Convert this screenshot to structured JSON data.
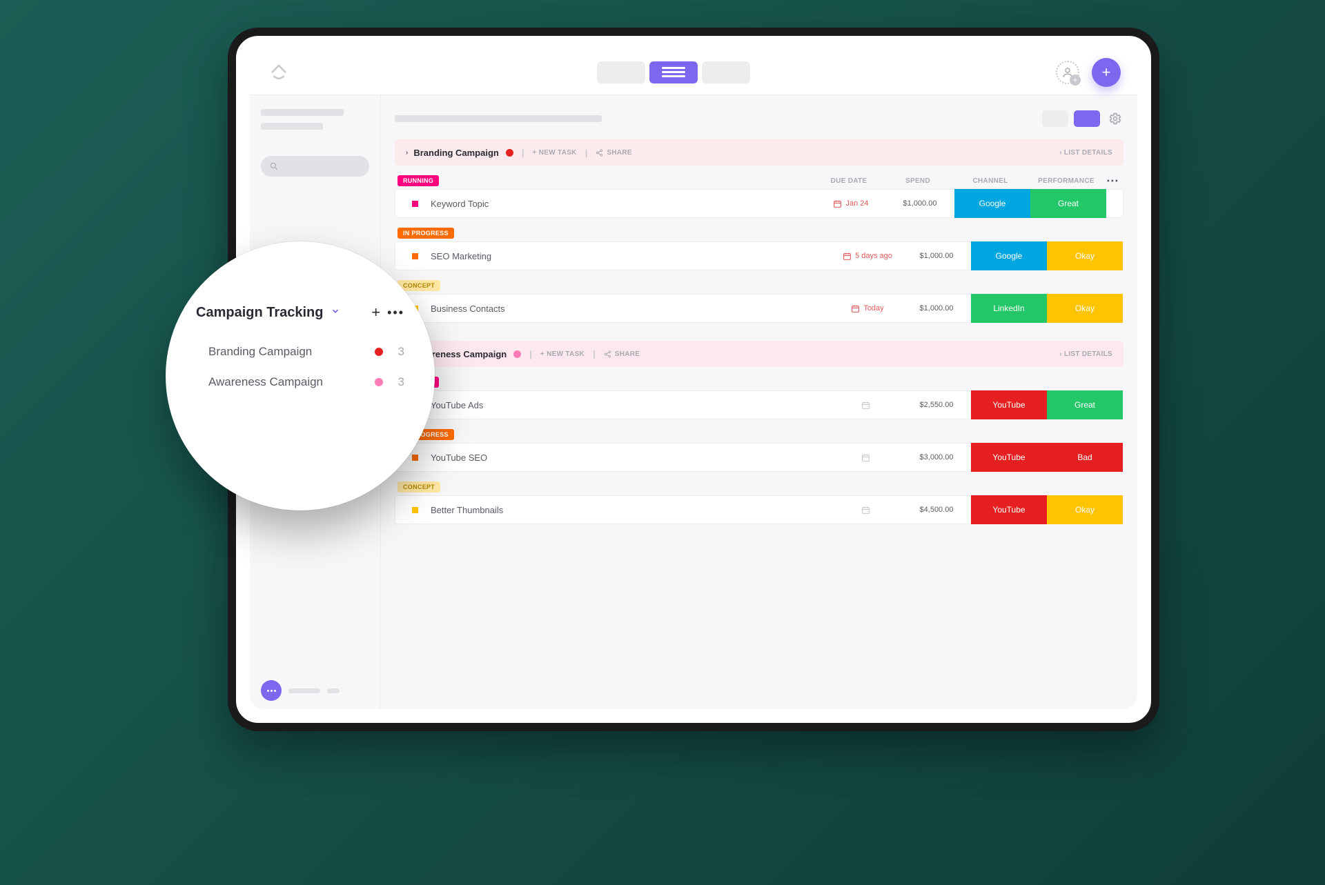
{
  "sidebar_zoom": {
    "title": "Campaign Tracking",
    "items": [
      {
        "name": "Branding Campaign",
        "dot": "red",
        "count": "3"
      },
      {
        "name": "Awareness Campaign",
        "dot": "pink",
        "count": "3"
      }
    ]
  },
  "actions": {
    "new_task": "+ NEW TASK",
    "share": "SHARE",
    "list_details": "› LIST DETAILS"
  },
  "columns": {
    "due": "DUE DATE",
    "spend": "SPEND",
    "channel": "CHANNEL",
    "performance": "PERFORMANCE"
  },
  "status_labels": {
    "running": "RUNNING",
    "in_progress": "IN PROGRESS",
    "concept": "CONCEPT"
  },
  "groups": [
    {
      "title": "Branding Campaign",
      "dot": "red",
      "sections": [
        {
          "status": "running",
          "show_headers": true,
          "tasks": [
            {
              "bullet": "pink",
              "name": "Keyword Topic",
              "due": "Jan 24",
              "due_muted": false,
              "spend": "$1,000.00",
              "channel": "Google",
              "channel_color": "blue",
              "perf": "Great",
              "perf_color": "green"
            }
          ]
        },
        {
          "status": "in_progress",
          "tasks": [
            {
              "bullet": "orange",
              "name": "SEO Marketing",
              "due": "5 days ago",
              "due_muted": false,
              "spend": "$1,000.00",
              "channel": "Google",
              "channel_color": "blue",
              "perf": "Okay",
              "perf_color": "yellow"
            }
          ]
        },
        {
          "status": "concept",
          "tasks": [
            {
              "bullet": "yellow",
              "name": "Business Contacts",
              "due": "Today",
              "due_muted": false,
              "spend": "$1,000.00",
              "channel": "LinkedIn",
              "channel_color": "green",
              "perf": "Okay",
              "perf_color": "yellow"
            }
          ]
        }
      ]
    },
    {
      "title": "Awareness Campaign",
      "dot": "pink",
      "sections": [
        {
          "status": "running",
          "tasks": [
            {
              "bullet": "pink",
              "name": "YouTube Ads",
              "due": "",
              "due_muted": true,
              "spend": "$2,550.00",
              "channel": "YouTube",
              "channel_color": "red",
              "perf": "Great",
              "perf_color": "green"
            }
          ]
        },
        {
          "status": "in_progress",
          "tasks": [
            {
              "bullet": "orange",
              "name": "YouTube SEO",
              "due": "",
              "due_muted": true,
              "spend": "$3,000.00",
              "channel": "YouTube",
              "channel_color": "red",
              "perf": "Bad",
              "perf_color": "red"
            }
          ]
        },
        {
          "status": "concept",
          "tasks": [
            {
              "bullet": "yellow",
              "name": "Better Thumbnails",
              "due": "",
              "due_muted": true,
              "spend": "$4,500.00",
              "channel": "YouTube",
              "channel_color": "red",
              "perf": "Okay",
              "perf_color": "yellow"
            }
          ]
        }
      ]
    }
  ]
}
